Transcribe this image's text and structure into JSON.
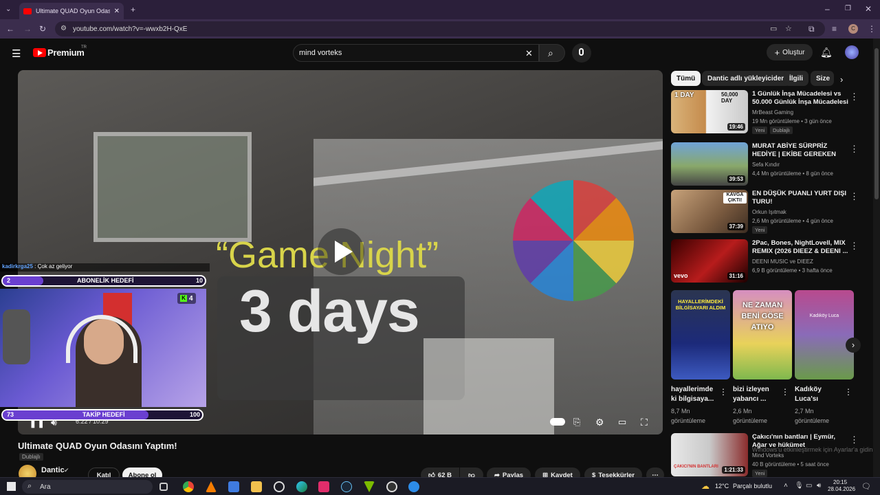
{
  "browser": {
    "tab_title": "Ultimate QUAD Oyun Odası",
    "url": "youtube.com/watch?v=-wwxb2H-QxE"
  },
  "youtube": {
    "logo_label": "Premium",
    "logo_region": "TR",
    "search_value": "mind vorteks",
    "create_label": "Oluştur"
  },
  "video": {
    "overlay_line1": "“Game Night”",
    "overlay_line2": "3 days",
    "time": "6:22 / 10:29",
    "title": "Ultimate QUAD Oyun Odasını Yaptım!",
    "dub_badge": "Dublajlı",
    "channel": "Dantic",
    "join_label": "Katıl",
    "subscribe_label": "Abone ol",
    "likes": "62 B",
    "share_label": "Paylaş",
    "save_label": "Kaydet",
    "thanks_label": "Teşekkürler"
  },
  "stream_overlay": {
    "chat_user": "kadirkrga25",
    "chat_message": ": Çok az geliyor",
    "goal1_current": "2",
    "goal1_label": "ABONELİK HEDEFİ",
    "goal1_target": "10",
    "kick_count": "4",
    "goal2_current": "73",
    "goal2_label": "TAKİP HEDEFİ",
    "goal2_target": "100",
    "goal1_progress": 0.2,
    "goal2_progress": 0.73
  },
  "chips": [
    "Tümü",
    "Dantic adlı yükleyiciden",
    "İlgili",
    "Size"
  ],
  "recommendations": [
    {
      "title": "1 Günlük İnşa Mücadelesi vs 50.000 Günlük İnşa Mücadelesi",
      "channel": "MrBeast Gaming",
      "meta": "19 Mn görüntüleme • 3 gün önce",
      "duration": "19:46",
      "badge": "Yeni",
      "badge2": "Dublajlı",
      "thumb_text": "1 DAY",
      "thumb_text2": "50,000 DAY"
    },
    {
      "title": "MURAT ABİYE SÜRPRİZ HEDİYE | EKİBE GEREKEN YAPILDI",
      "channel": "Sefa Kındır",
      "meta": "4,4 Mn görüntüleme • 8 gün önce",
      "duration": "39:53"
    },
    {
      "title": "EN DÜŞÜK PUANLI YURT DIŞI TURU!",
      "channel": "Orkun Işıtmak",
      "meta": "2,6 Mn görüntüleme • 4 gün önce",
      "duration": "37:39",
      "badge": "Yeni",
      "thumb_text": "KAVGA ÇIKTI!"
    },
    {
      "title": "2Pac, Bones, NightLovell, MIX REMIX (2026 DIEEZ & DEENI ...",
      "channel": "DEENI MUSIC ve DIEEZ",
      "meta": "6,9 B görüntüleme • 3 hafta önce",
      "duration": "31:16",
      "thumb_text": "vevo"
    },
    {
      "title": "Çakıcı'nın bantları | Eymür, Ağar ve hükümet",
      "channel": "Mind Vorteks",
      "meta": "40 B görüntüleme • 5 saat önce",
      "duration": "1:21:33",
      "badge": "Yeni",
      "thumb_text": "ÇAKICI'NIN BANTLARI"
    }
  ],
  "shorts": [
    {
      "caption": "hayallerimde ki bilgisaya...",
      "views": "8,7 Mn görüntüleme",
      "thumb_text": "HAYALLERİMDEKİ BİLGİSAYARI ALDIM"
    },
    {
      "caption": "bizi izleyen yabancı ...",
      "views": "2,6 Mn görüntüleme",
      "thumb_text": "NE ZAMAN BENİ GÖSE ATIYO"
    },
    {
      "caption": "Kadıköy Luca'sı",
      "views": "2,7 Mn görüntüleme",
      "thumb_text": "Kadıköy Luca"
    }
  ],
  "windows_notice": "Windows'u etkinleştirmek için Ayarlar'a gidin.",
  "taskbar": {
    "search_placeholder": "Ara",
    "weather": "12°C",
    "weather_desc": "Parçalı bulutlu",
    "time": "20:15",
    "date": "28.04.2026"
  },
  "colors": {
    "youtube_red": "#ff0000",
    "accent_purple": "#6a3fd0",
    "game_night_yellow": "#d8d44a"
  }
}
